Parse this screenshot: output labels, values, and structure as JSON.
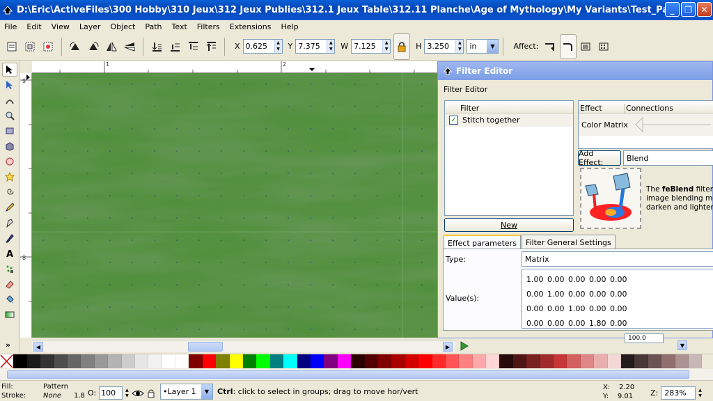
{
  "window": {
    "title": "D:\\Eric\\ActiveFiles\\300 Hobby\\310 Jeux\\312 Jeux Publies\\312.1 Jeux Table\\312.11 Planche\\Age of Mythology\\My Variants\\Test_PatternBug.svg - I...",
    "buttons": [
      "_",
      "❐",
      "✕"
    ]
  },
  "menu": [
    "File",
    "Edit",
    "View",
    "Layer",
    "Object",
    "Path",
    "Text",
    "Filters",
    "Extensions",
    "Help"
  ],
  "toolbar": {
    "x_label": "X",
    "x_value": "0.625",
    "y_label": "Y",
    "y_value": "7.375",
    "w_label": "W",
    "w_value": "7.125",
    "h_label": "H",
    "h_value": "3.250",
    "unit": "in",
    "affect_label": "Affect:"
  },
  "ruler": {
    "top_labels": [
      "1",
      "2"
    ],
    "left_labels": [
      "9",
      "8"
    ]
  },
  "dialog": {
    "title": "Filter Editor",
    "subtitle": "Filter Editor",
    "filter_header": "Filter",
    "filter_item": "Stitch together",
    "new_button": "New",
    "effect_header": "Effect",
    "connections_header": "Connections",
    "effect_item": "Color Matrix",
    "add_effect_button": "Add Effect:",
    "effect_combo": "Blend",
    "desc_prefix": "The ",
    "desc_bold": "feBlend",
    "desc_line1": " filter p",
    "desc_line2": "image blending mode",
    "desc_line3": "darken and lighten.",
    "tab_effect_params": "Effect parameters",
    "tab_general": "Filter General Settings",
    "type_label": "Type:",
    "type_value": "Matrix",
    "values_label": "Value(s):",
    "matrix": [
      [
        "1.00",
        "0.00",
        "0.00",
        "0.00",
        "0.00"
      ],
      [
        "0.00",
        "1.00",
        "0.00",
        "0.00",
        "0.00"
      ],
      [
        "0.00",
        "0.00",
        "1.00",
        "0.00",
        "0.00"
      ],
      [
        "0.00",
        "0.00",
        "0.00",
        "1.80",
        "0.00"
      ]
    ],
    "bottom_value": "100.0"
  },
  "palette": [
    "#ffffff",
    "#000000",
    "#1a1a1a",
    "#333333",
    "#4d4d4d",
    "#666666",
    "#808080",
    "#999999",
    "#b3b3b3",
    "#cccccc",
    "#e6e6e6",
    "#f2f2f2",
    "#ffffff",
    "#ffffff",
    "#800000",
    "#ff0000",
    "#808000",
    "#ffff00",
    "#008000",
    "#00ff00",
    "#008080",
    "#00ffff",
    "#000080",
    "#0000ff",
    "#800080",
    "#ff00ff",
    "#2b0000",
    "#550000",
    "#800000",
    "#aa0000",
    "#d40000",
    "#ff0000",
    "#ff2a2a",
    "#ff5555",
    "#ff8080",
    "#ffaaaa",
    "#ffd5d5",
    "#280b0b",
    "#501616",
    "#782121",
    "#a02c2c",
    "#c83737",
    "#d35f5f",
    "#de8787",
    "#e9afaf",
    "#f4d7d7",
    "#241c1c",
    "#483737",
    "#6c5353",
    "#916f6f",
    "#ac9393",
    "#c8b7b7"
  ],
  "status": {
    "fill_label": "Fill:",
    "stroke_label": "Stroke:",
    "fill_value": "Pattern",
    "stroke_value": "None",
    "stroke_width": "1.8",
    "opacity_label": "O:",
    "opacity_value": "100",
    "layer": "•Layer 1",
    "msg_bold": "Ctrl",
    "msg_rest": ": click to select in groups; drag to move hor/vert",
    "x_label": "X:",
    "x_value": "2.20",
    "y_label": "Y:",
    "y_value": "9.01",
    "zoom_label": "Z:",
    "zoom_value": "283%"
  },
  "colors": {
    "canvas_green": "#2f6f22",
    "title_blue": "#0a55cf"
  }
}
